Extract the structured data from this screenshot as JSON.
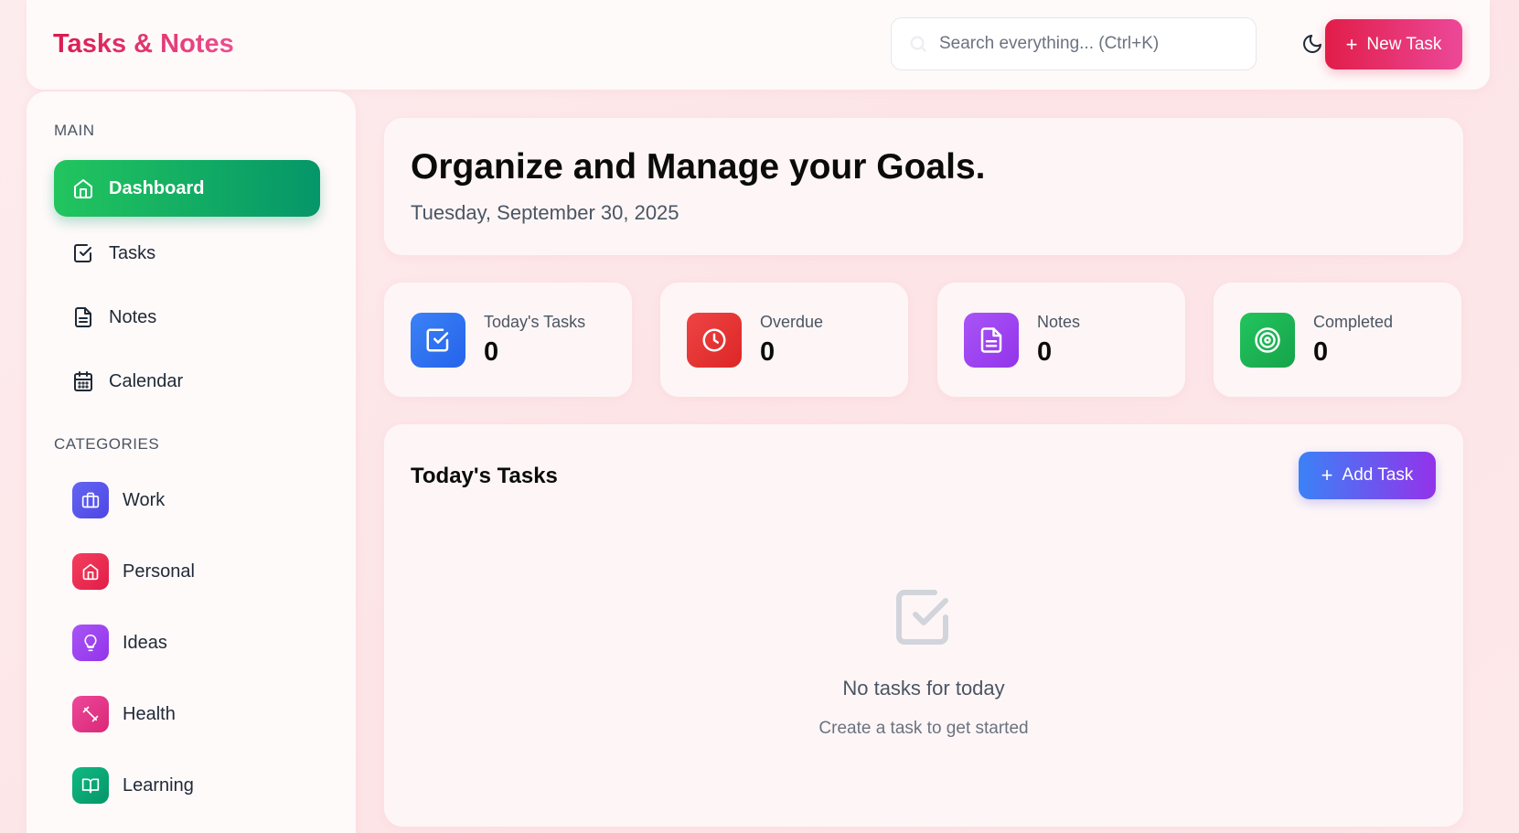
{
  "header": {
    "brand": "Tasks & Notes",
    "search_placeholder": "Search everything... (Ctrl+K)",
    "new_task_label": "New Task"
  },
  "sidebar": {
    "main_label": "MAIN",
    "nav": [
      {
        "label": "Dashboard",
        "icon": "home-icon",
        "active": true
      },
      {
        "label": "Tasks",
        "icon": "check-square-icon"
      },
      {
        "label": "Notes",
        "icon": "file-text-icon"
      },
      {
        "label": "Calendar",
        "icon": "calendar-icon"
      }
    ],
    "categories_label": "CATEGORIES",
    "categories": [
      {
        "label": "Work",
        "icon": "briefcase-icon",
        "color": "#6366f1"
      },
      {
        "label": "Personal",
        "icon": "home-icon",
        "color": "#e11d48"
      },
      {
        "label": "Ideas",
        "icon": "lightbulb-icon",
        "color": "#a855f7"
      },
      {
        "label": "Health",
        "icon": "dumbbell-icon",
        "color": "#ec4899"
      },
      {
        "label": "Learning",
        "icon": "book-open-icon",
        "color": "#059669"
      }
    ]
  },
  "welcome": {
    "title": "Organize and Manage your Goals.",
    "date": "Tuesday, September 30, 2025"
  },
  "stats": [
    {
      "label": "Today's Tasks",
      "value": "0",
      "icon": "check-square-icon",
      "color_from": "#3b82f6",
      "color_to": "#2563eb"
    },
    {
      "label": "Overdue",
      "value": "0",
      "icon": "clock-icon",
      "color_from": "#ef4444",
      "color_to": "#dc2626"
    },
    {
      "label": "Notes",
      "value": "0",
      "icon": "file-text-icon",
      "color_from": "#a855f7",
      "color_to": "#9333ea"
    },
    {
      "label": "Completed",
      "value": "0",
      "icon": "target-icon",
      "color_from": "#22c55e",
      "color_to": "#16a34a"
    }
  ],
  "today_tasks": {
    "title": "Today's Tasks",
    "add_label": "Add Task",
    "empty_title": "No tasks for today",
    "empty_subtitle": "Create a task to get started"
  }
}
